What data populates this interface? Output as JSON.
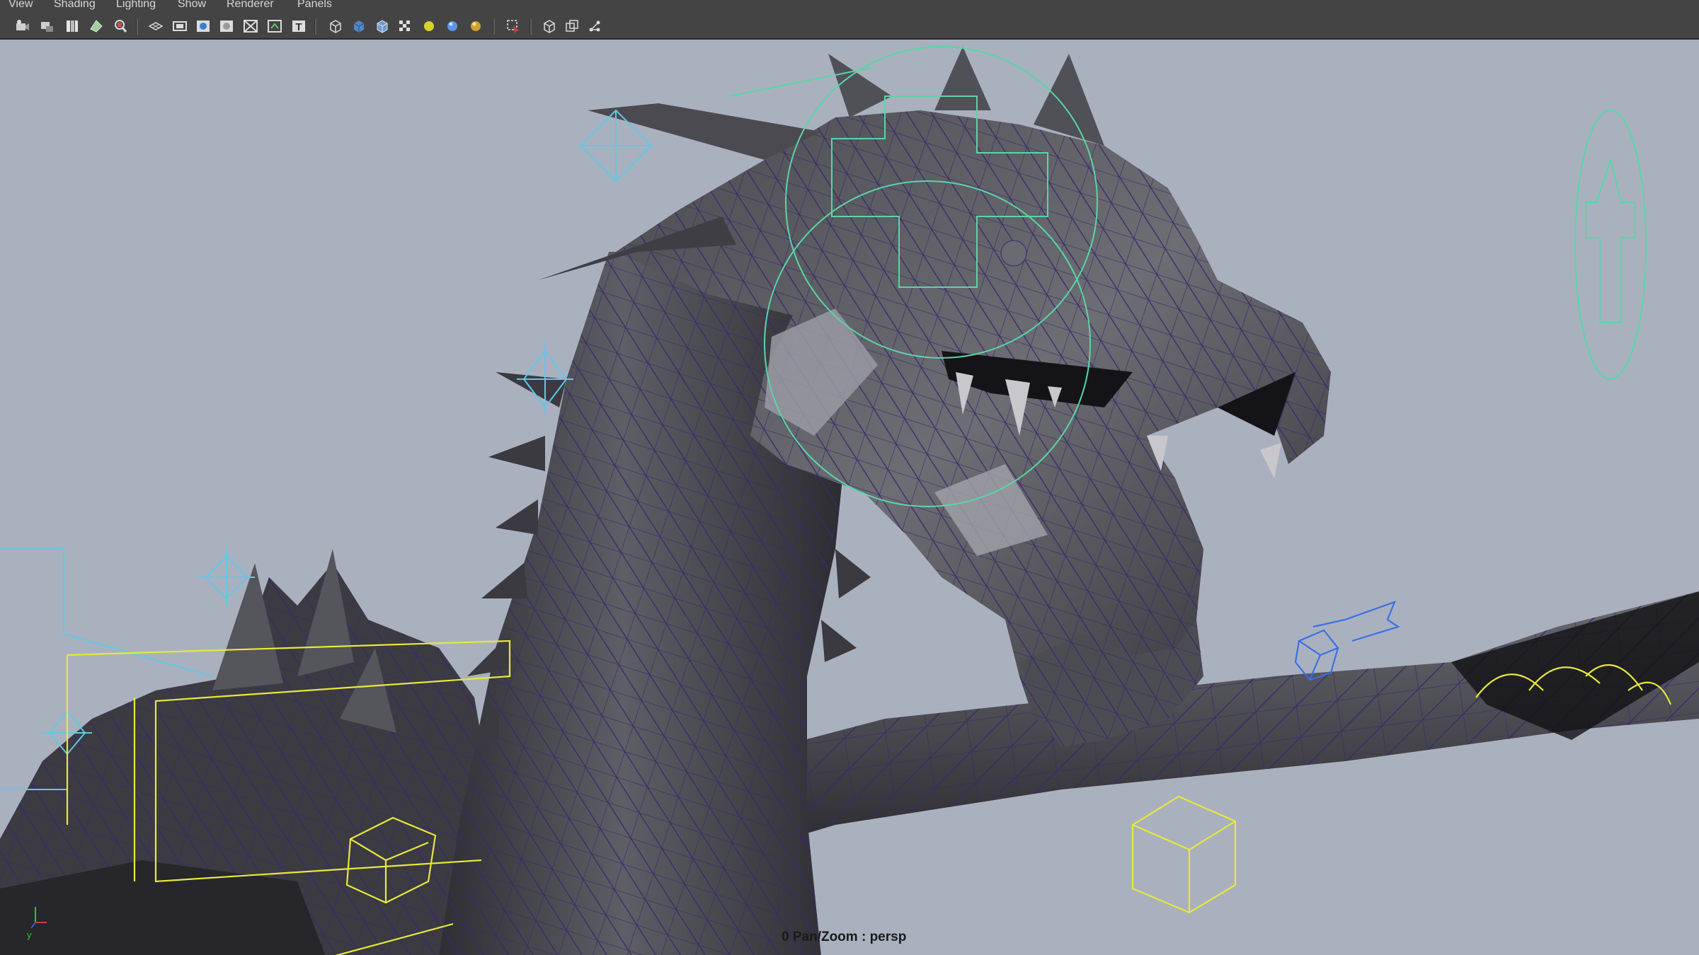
{
  "menu": {
    "view": "View",
    "shading": "Shading",
    "lighting": "Lighting",
    "show": "Show",
    "renderer": "Renderer",
    "panels": "Panels"
  },
  "toolbar_icons": [
    "select-camera-icon",
    "camera-attributes-icon",
    "bookmarks-icon",
    "image-plane-icon",
    "2d-pan-zoom-icon",
    "grid-icon",
    "film-gate-icon",
    "resolution-gate-icon",
    "gate-mask-icon",
    "field-chart-icon",
    "safe-title-icon",
    "wireframe-icon",
    "smooth-shade-icon",
    "smooth-shade-wireframe-icon",
    "textured-icon",
    "use-default-light-icon",
    "use-all-lights-icon",
    "shadows-icon",
    "isolate-select-icon",
    "xray-icon",
    "xray-joints-icon",
    "hud-icon"
  ],
  "viewport": {
    "camera_status": "0 Pan/Zoom : persp",
    "axis_y": "y"
  },
  "colors": {
    "viewport_bg": "#a9b1bf",
    "mesh_dark": "#38383e",
    "mesh_mid": "#5a5a62",
    "wire": "#3a2a6b",
    "control_green": "#59d6a6",
    "control_yellow": "#e8e83a",
    "control_blue": "#3a6ee8",
    "locator_cyan": "#62c8e6"
  }
}
